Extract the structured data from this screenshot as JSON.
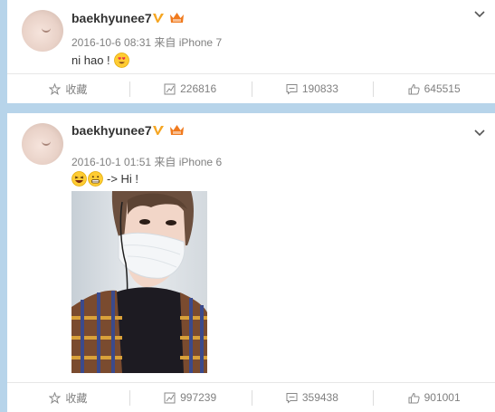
{
  "posts": [
    {
      "username": "baekhyunee7",
      "meta": "2016-10-6 08:31 来自 iPhone 7",
      "text": "ni hao !",
      "actions": {
        "favorite": "收藏",
        "repost": "226816",
        "comment": "190833",
        "like": "645515"
      }
    },
    {
      "username": "baekhyunee7",
      "meta": "2016-10-1 01:51 来自 iPhone 6",
      "text": "-> Hi !",
      "actions": {
        "favorite": "收藏",
        "repost": "997239",
        "comment": "359438",
        "like": "901001"
      }
    }
  ],
  "icons": {
    "vip_badge": "verified-v-icon",
    "member_badge": "crown-icon",
    "menu": "chevron-down-icon",
    "favorite": "star-icon",
    "repost": "repost-icon",
    "comment": "comment-icon",
    "like": "thumbs-up-icon"
  },
  "colors": {
    "page_bg": "#b7d4ea",
    "vip_gold": "#f5a623",
    "text_gray": "#808080"
  }
}
